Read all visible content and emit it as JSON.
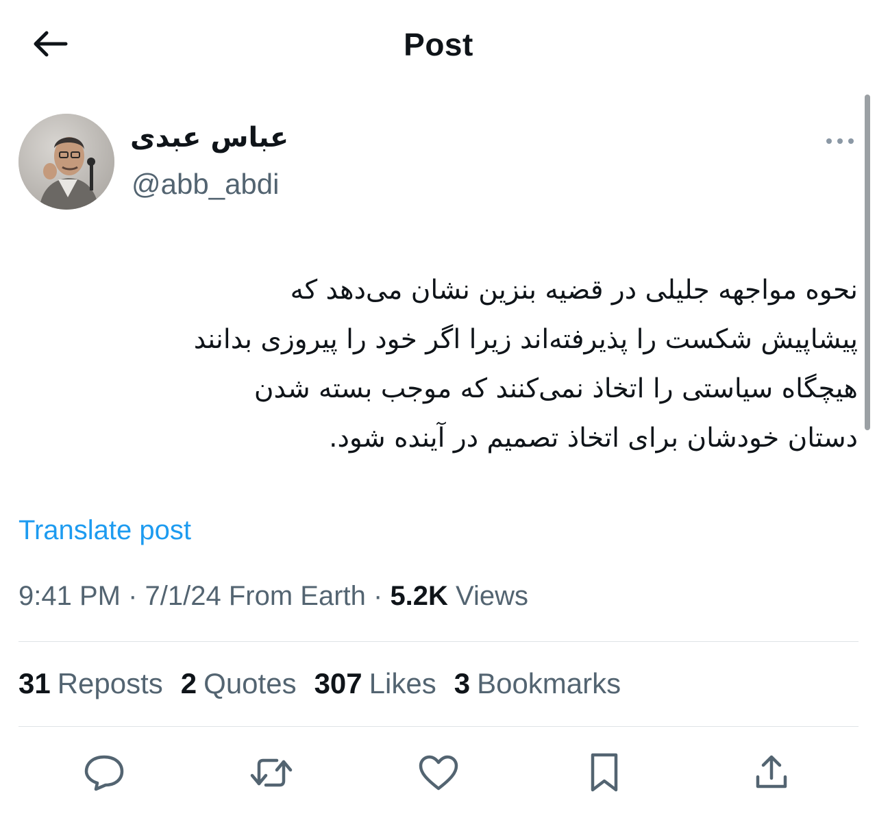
{
  "header": {
    "title": "Post",
    "back_icon": "arrow-left-icon"
  },
  "author": {
    "display_name": "عباس عبدی",
    "handle": "@abb_abdi",
    "more_icon": "more-horizontal-icon"
  },
  "post": {
    "lines": [
      "نحوه مواجهه جلیلی در قضیه بنزین نشان می‌دهد که",
      "پیشاپیش شکست را پذیرفته‌اند زیرا اگر خود را پیروزی بدانند",
      "هیچگاه سیاستی را اتخاذ نمی‌کنند که موجب بسته شدن",
      "دستان خودشان برای اتخاذ تصمیم در آینده شود."
    ],
    "translate_label": "Translate post"
  },
  "meta": {
    "time": "9:41 PM",
    "separator": " · ",
    "date": "7/1/24",
    "source": " From Earth",
    "views_count": "5.2K",
    "views_label": " Views"
  },
  "stats": {
    "reposts": {
      "count": "31",
      "label": "Reposts"
    },
    "quotes": {
      "count": "2",
      "label": "Quotes"
    },
    "likes": {
      "count": "307",
      "label": "Likes"
    },
    "bookmarks": {
      "count": "3",
      "label": "Bookmarks"
    }
  },
  "actions": [
    {
      "name": "reply",
      "icon": "reply-icon"
    },
    {
      "name": "repost",
      "icon": "repost-icon"
    },
    {
      "name": "like",
      "icon": "heart-icon"
    },
    {
      "name": "bookmark",
      "icon": "bookmark-icon"
    },
    {
      "name": "share",
      "icon": "share-icon"
    }
  ],
  "colors": {
    "link": "#1d9bf0",
    "secondary_text": "#536471",
    "primary_text": "#0f1419",
    "divider": "#dfe3e6"
  }
}
